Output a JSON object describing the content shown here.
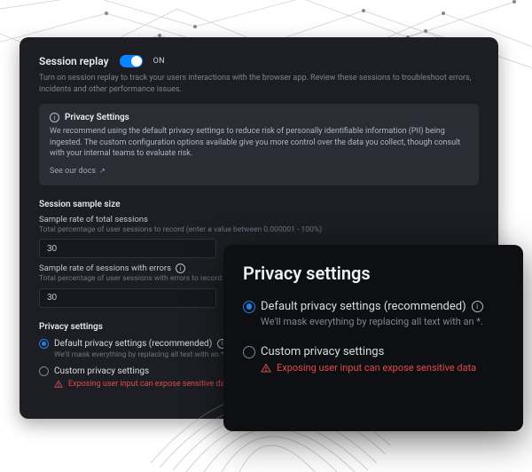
{
  "header": {
    "title": "Session replay",
    "toggle_state": "ON",
    "description": "Turn on session replay to track your users interactions with the browser app. Review these sessions to troubleshoot errors, incidents and other performance issues."
  },
  "infobox": {
    "title": "Privacy Settings",
    "body": "We recommend using the default privacy settings to reduce risk of personally identifiable information (PII) being ingested. The custom configuration options available give you more control over the data you collect, though consult with your internal teams to evaluate risk.",
    "link_label": "See our docs"
  },
  "sample": {
    "section_title": "Session sample size",
    "total": {
      "label": "Sample rate of total sessions",
      "hint": "Total percentage of user sessions to record (enter a value between 0.000001 - 100%)",
      "value": "30"
    },
    "errors": {
      "label": "Sample rate of sessions with errors",
      "hint": "Total percentage of user sessions with errors to record (enter a",
      "value": "30"
    }
  },
  "privacy": {
    "section_title": "Privacy settings",
    "default": {
      "label": "Default privacy settings (recommended)",
      "hint": "We'll mask everything by replacing all text with an *"
    },
    "custom": {
      "label": "Custom privacy settings",
      "warning": "Exposing user input can expose sensitive data"
    }
  },
  "overlay": {
    "title": "Privacy settings",
    "default": {
      "label": "Default privacy settings (recommended)",
      "hint": "We'll mask everything by replacing all text with an *."
    },
    "custom": {
      "label": "Custom privacy settings",
      "warning": "Exposing user input can expose sensitive data"
    }
  }
}
